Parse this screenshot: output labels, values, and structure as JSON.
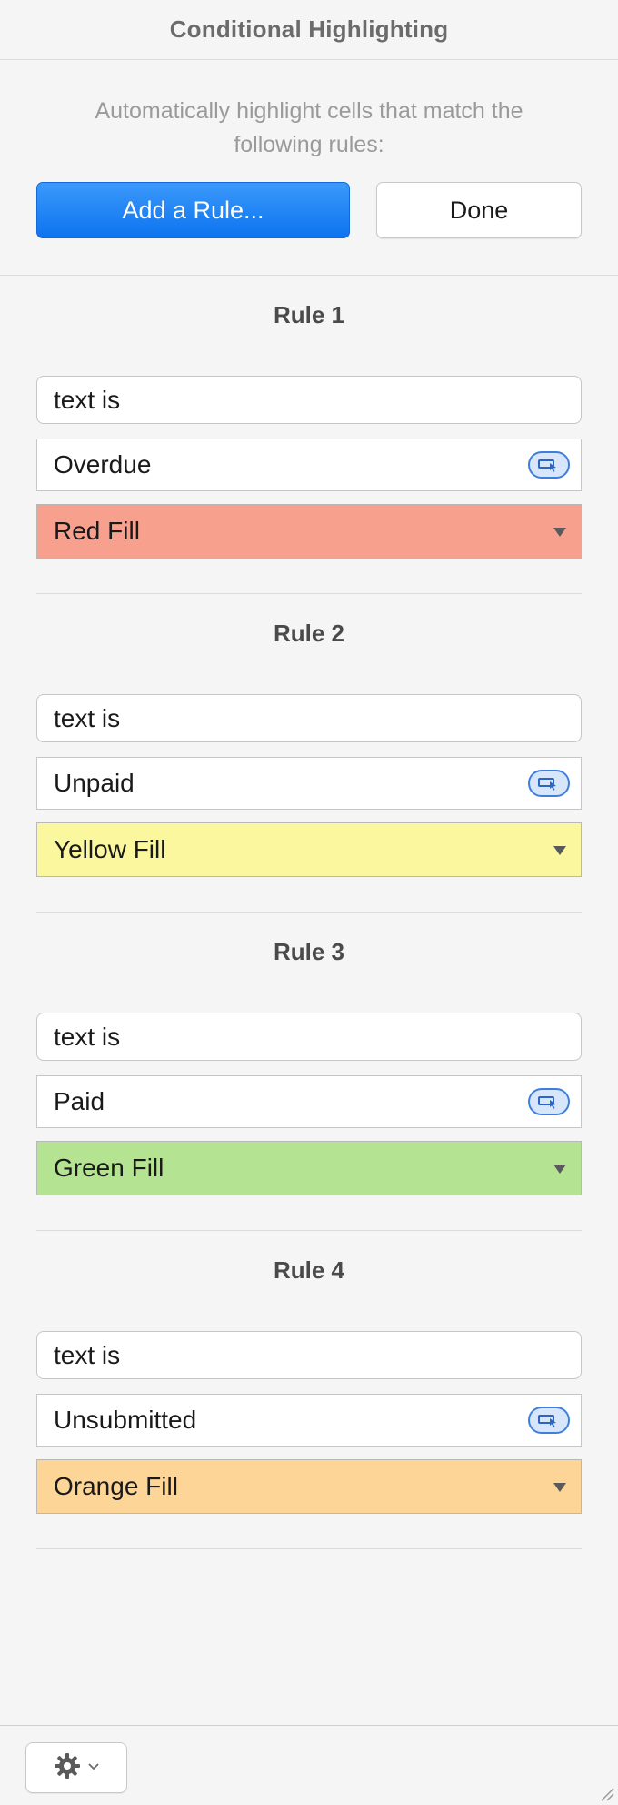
{
  "panel": {
    "title": "Conditional Highlighting"
  },
  "header": {
    "description": "Automatically highlight cells that match the following rules:",
    "add_rule_label": "Add a Rule...",
    "done_label": "Done"
  },
  "rules": [
    {
      "title": "Rule 1",
      "condition": "text is",
      "value": "Overdue",
      "fill": "Red Fill",
      "fill_color": "#f7a08e"
    },
    {
      "title": "Rule 2",
      "condition": "text is",
      "value": "Unpaid",
      "fill": "Yellow Fill",
      "fill_color": "#fbf79e"
    },
    {
      "title": "Rule 3",
      "condition": "text is",
      "value": "Paid",
      "fill": "Green Fill",
      "fill_color": "#b4e391"
    },
    {
      "title": "Rule 4",
      "condition": "text is",
      "value": "Unsubmitted",
      "fill": "Orange Fill",
      "fill_color": "#fdd597"
    }
  ],
  "colors": {
    "accent": "#0d74ef",
    "token_border": "#3f7fdc",
    "token_fill": "#d7e6fb"
  },
  "icons": {
    "token": "cell-reference-icon",
    "gear": "gear-icon",
    "chevron": "chevron-down-icon",
    "grip": "resize-grip-icon"
  }
}
